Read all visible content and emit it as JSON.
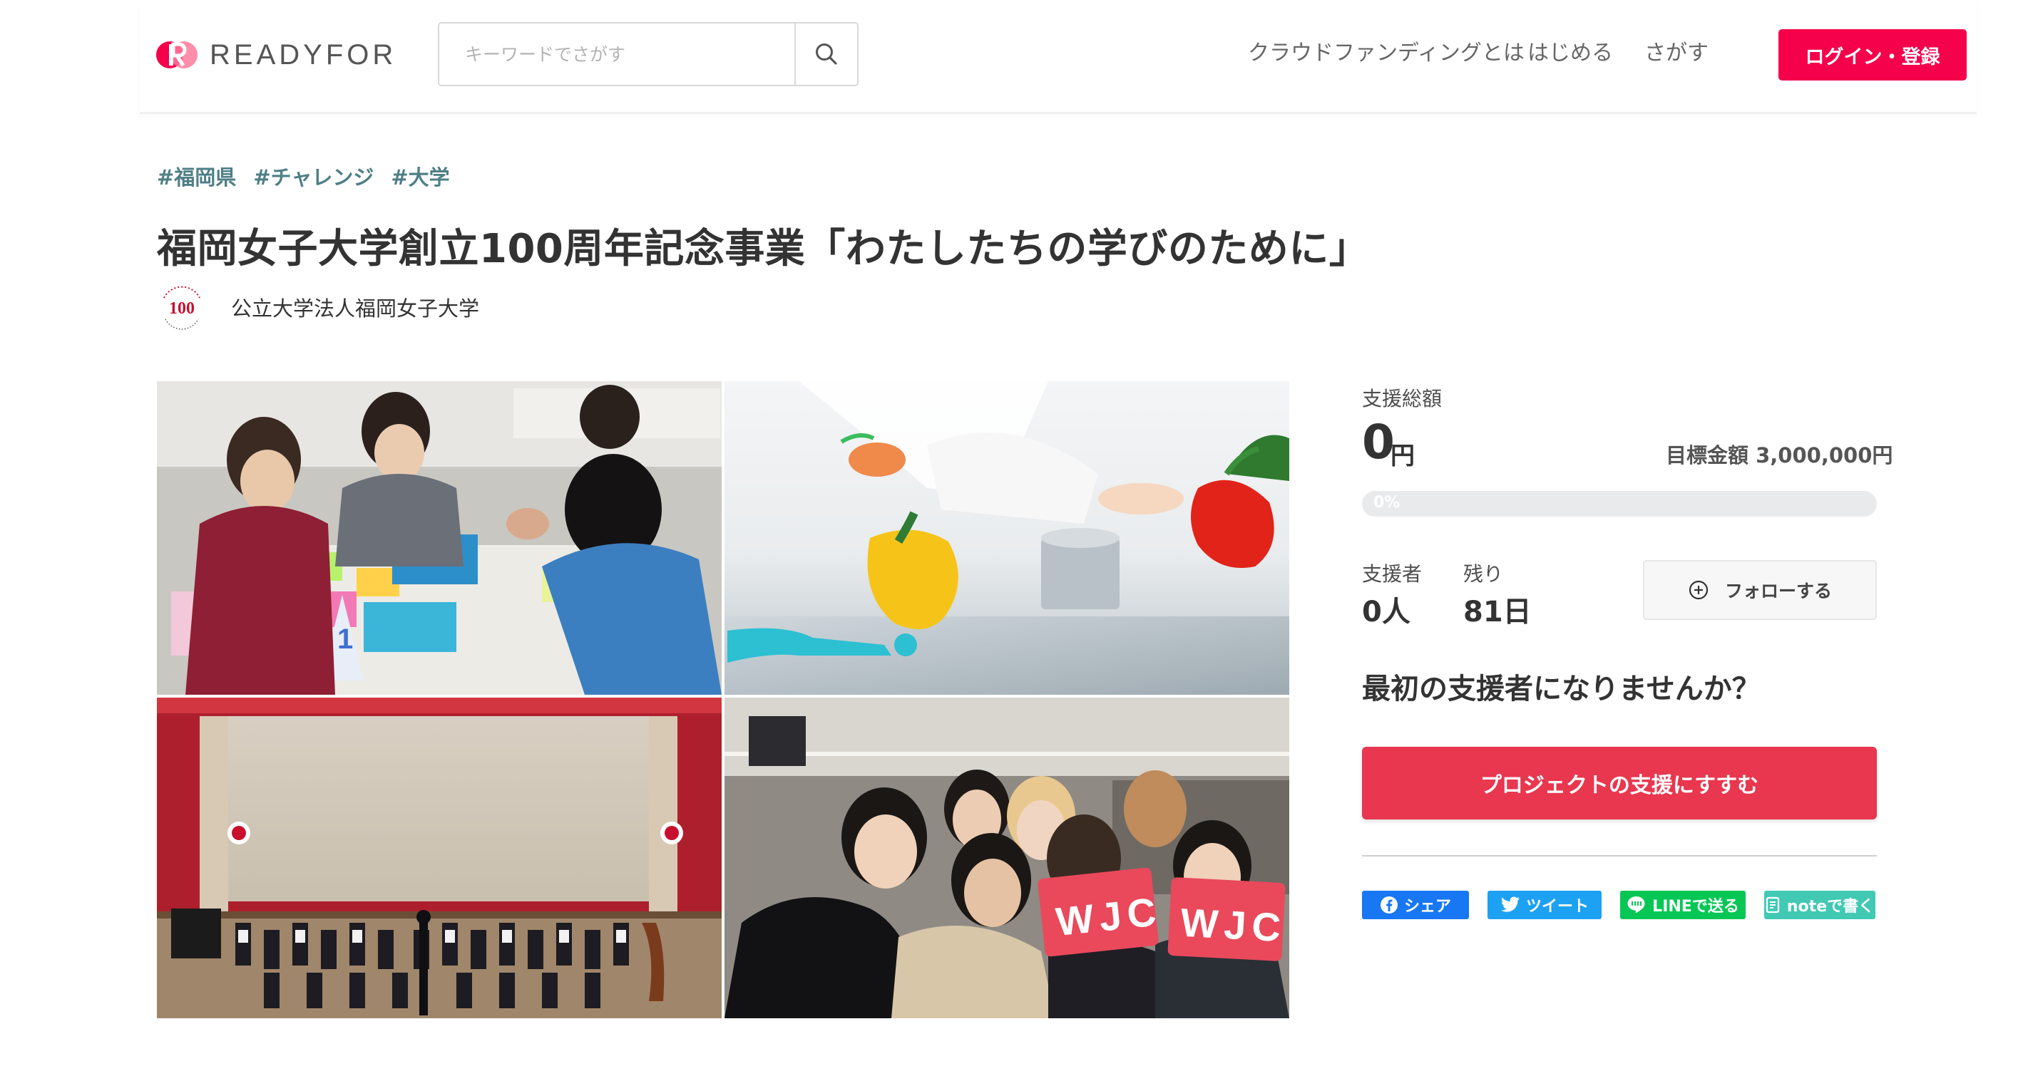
{
  "header": {
    "logo_text": "READYFOR",
    "search_placeholder": "キーワードでさがす",
    "nav": [
      "クラウドファンディングとは",
      "はじめる",
      "さがす"
    ],
    "login_label": "ログイン・登録"
  },
  "project": {
    "tags": [
      "#福岡県",
      "#チャレンジ",
      "#大学"
    ],
    "title": "福岡女子大学創立100周年記念事業「わたしたちの学びのために」",
    "owner": "公立大学法人福岡女子大学",
    "owner_logo_text": "100"
  },
  "collage": {
    "sign1": "WJC",
    "sign2": "WJC",
    "table_number": "1"
  },
  "stats": {
    "total_label": "支援総額",
    "total_amount": "0",
    "total_unit": "円",
    "goal_text": "目標金額 3,000,000円",
    "progress_percent": 0,
    "progress_label": "0%",
    "supporters_label": "支援者",
    "supporters_value": "0人",
    "remaining_label": "残り",
    "remaining_value": "81日",
    "follow_label": "フォローする",
    "first_prompt": "最初の支援者になりませんか？",
    "support_button": "プロジェクトの支援にすすむ"
  },
  "share": {
    "facebook": "シェア",
    "twitter": "ツイート",
    "line": "LINEで送る",
    "note": "noteで書く"
  },
  "colors": {
    "brand": "#f5004b",
    "cta": "#e8374f",
    "tag": "#4e7f86",
    "facebook": "#1877f2",
    "twitter": "#1da1f2",
    "line": "#06c755",
    "note": "#41c9b4"
  }
}
